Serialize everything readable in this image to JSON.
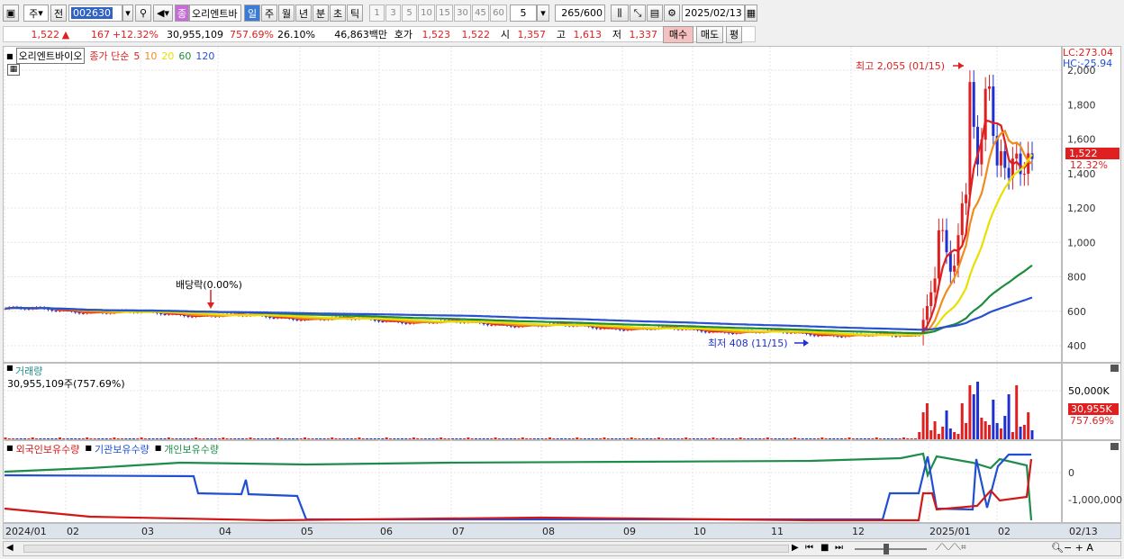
{
  "toolbar": {
    "type_select": "주",
    "prev_button": "전",
    "stock_code": "002630",
    "stock_name": "오리엔트바",
    "name_badge": "종",
    "periods": [
      "일",
      "주",
      "월",
      "년",
      "분",
      "초",
      "틱"
    ],
    "active_period": "일",
    "intervals": [
      "1",
      "3",
      "5",
      "10",
      "15",
      "30",
      "45",
      "60"
    ],
    "interval_value": "5",
    "count_current": "265",
    "count_total": "/600",
    "date": "2025/02/13"
  },
  "quote": {
    "price": "1,522",
    "arrow": "▲",
    "change": "167",
    "change_pct": "+12.32%",
    "volume": "30,955,109",
    "volume_pct": "757.69%",
    "turnover": "26.10%",
    "amount": "46,863백만",
    "bid_label": "호가",
    "ask_price": "1,523",
    "bid_price": "1,522",
    "open_label": "시",
    "open": "1,357",
    "high_label": "고",
    "high": "1,613",
    "low_label": "저",
    "low": "1,337",
    "buy_button": "매수",
    "sell_button": "매도",
    "eval_button": "평"
  },
  "price_panel": {
    "stock_label": "오리엔트바이오",
    "ma_label": "종가 단순",
    "ma_periods": [
      {
        "label": "5",
        "color": "#e02020"
      },
      {
        "label": "10",
        "color": "#f08c1e"
      },
      {
        "label": "20",
        "color": "#e8e000"
      },
      {
        "label": "60",
        "color": "#1e8c3c"
      },
      {
        "label": "120",
        "color": "#2850d0"
      }
    ],
    "lc_label": "LC:273.04",
    "hc_label": "HC:-25.94",
    "last_price_tag": "1,522",
    "last_pct_tag": "12.32%",
    "high_annotation": "최고 2,055 (01/15)",
    "low_annotation": "최저 408 (11/15)",
    "dividend_annotation": "배당락(0.00%)",
    "y_ticks": [
      "2,000",
      "1,800",
      "1,600",
      "1,400",
      "1,200",
      "1,000",
      "800",
      "600",
      "400"
    ]
  },
  "volume_panel": {
    "title": "거래량",
    "value_label": "30,955,109주(757.69%)",
    "y_tick": "50,000K",
    "last_tag": "30,955K",
    "last_pct": "757.69%"
  },
  "holdings_panel": {
    "series": [
      {
        "label": "외국인보유수량",
        "color": "#d01818"
      },
      {
        "label": "기관보유수량",
        "color": "#2050d0"
      },
      {
        "label": "개인보유수량",
        "color": "#1e8c4a"
      }
    ],
    "y_ticks": [
      "0",
      "-1,000,000"
    ]
  },
  "x_axis": [
    "2024/01",
    "02",
    "03",
    "04",
    "05",
    "06",
    "07",
    "08",
    "09",
    "10",
    "11",
    "12",
    "2025/01",
    "02",
    "02/13"
  ],
  "colors": {
    "up": "#e02020",
    "down": "#2030d0",
    "accent": "#3a7bd5"
  }
}
